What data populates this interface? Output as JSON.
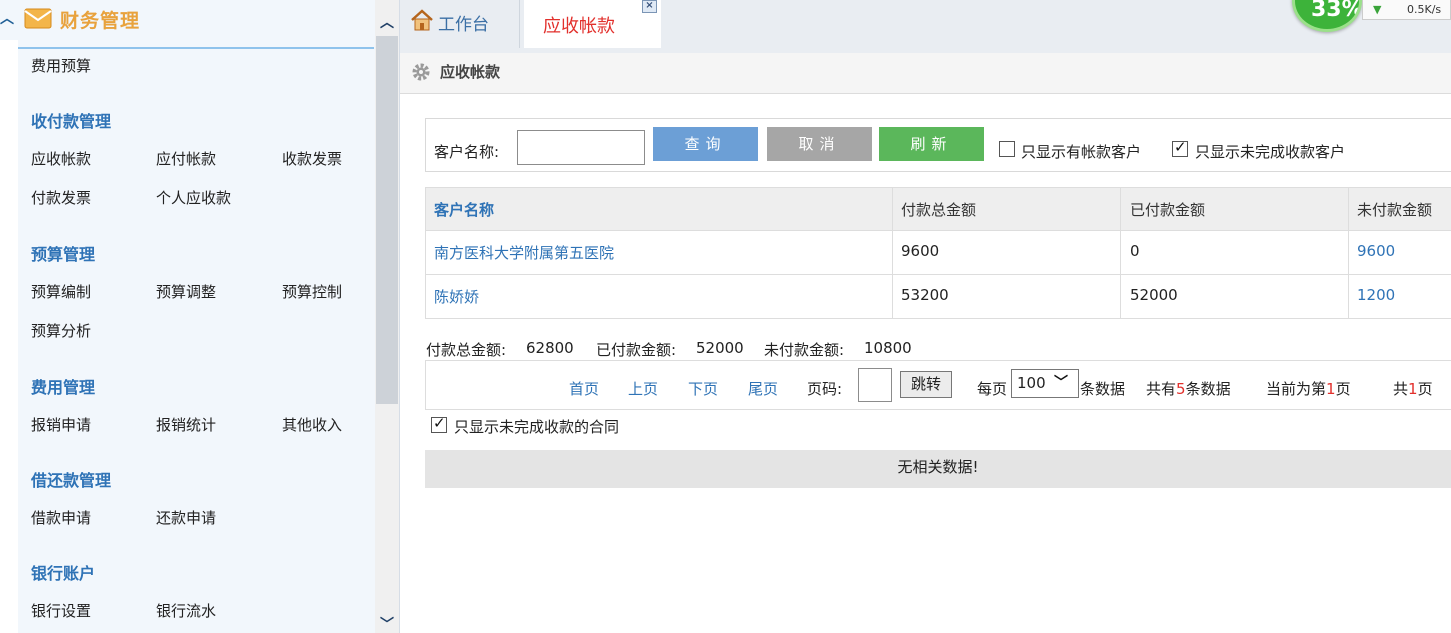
{
  "sidebar": {
    "title": "财务管理",
    "groups": [
      {
        "items": [
          {
            "label": "费用预算"
          }
        ]
      },
      {
        "title": "收付款管理",
        "items": [
          {
            "label": "应收帐款"
          },
          {
            "label": "应付帐款"
          },
          {
            "label": "收款发票"
          },
          {
            "label": "付款发票"
          },
          {
            "label": "个人应收款"
          }
        ]
      },
      {
        "title": "预算管理",
        "items": [
          {
            "label": "预算编制"
          },
          {
            "label": "预算调整"
          },
          {
            "label": "预算控制"
          },
          {
            "label": "预算分析"
          }
        ]
      },
      {
        "title": "费用管理",
        "items": [
          {
            "label": "报销申请"
          },
          {
            "label": "报销统计"
          },
          {
            "label": "其他收入"
          }
        ]
      },
      {
        "title": "借还款管理",
        "items": [
          {
            "label": "借款申请"
          },
          {
            "label": "还款申请"
          }
        ]
      },
      {
        "title": "银行账户",
        "items": [
          {
            "label": "银行设置"
          },
          {
            "label": "银行流水"
          }
        ]
      }
    ]
  },
  "tabs": [
    {
      "label": "工作台",
      "icon": "home-icon"
    },
    {
      "label": "应收帐款",
      "active": true
    }
  ],
  "tab_close_label": "×",
  "widget": {
    "ring_text": "33%",
    "speed": "0.5K/s"
  },
  "panel": {
    "title": "应收帐款",
    "icon": "gear-icon"
  },
  "search": {
    "label": "客户名称:",
    "input_value": "",
    "query_label": "查询",
    "cancel_label": "取消",
    "refresh_label": "刷新",
    "checkbox_has_ar": {
      "label": "只显示有帐款客户",
      "checked": false
    },
    "checkbox_unfinished": {
      "label": "只显示未完成收款客户",
      "checked": true
    }
  },
  "table": {
    "columns": [
      "客户名称",
      "付款总金额",
      "已付款金额",
      "未付款金额"
    ],
    "rows": [
      {
        "name": "南方医科大学附属第五医院",
        "total": "9600",
        "paid": "0",
        "unpaid": "9600"
      },
      {
        "name": "陈娇娇",
        "total": "53200",
        "paid": "52000",
        "unpaid": "1200"
      }
    ]
  },
  "summary": {
    "total_label": "付款总金额:",
    "total_value": "62800",
    "paid_label": "已付款金额:",
    "paid_value": "52000",
    "unpaid_label": "未付款金额:",
    "unpaid_value": "10800"
  },
  "pager": {
    "first": "首页",
    "prev": "上页",
    "next": "下页",
    "last": "尾页",
    "page_label": "页码:",
    "page_input": "",
    "jump": "跳转",
    "per_page_label": "每页",
    "per_page_value": "100",
    "per_page_suffix": "条数据",
    "total_prefix": "共有",
    "total_count": "5",
    "total_suffix": "条数据",
    "current_prefix": "当前为第",
    "current_page": "1",
    "current_suffix": "页",
    "pages_prefix": "共",
    "pages_count": "1",
    "pages_suffix": "页"
  },
  "contract_filter": {
    "label": "只显示未完成收款的合同",
    "checked": true
  },
  "no_data": "无相关数据!",
  "checkmark": "✓"
}
